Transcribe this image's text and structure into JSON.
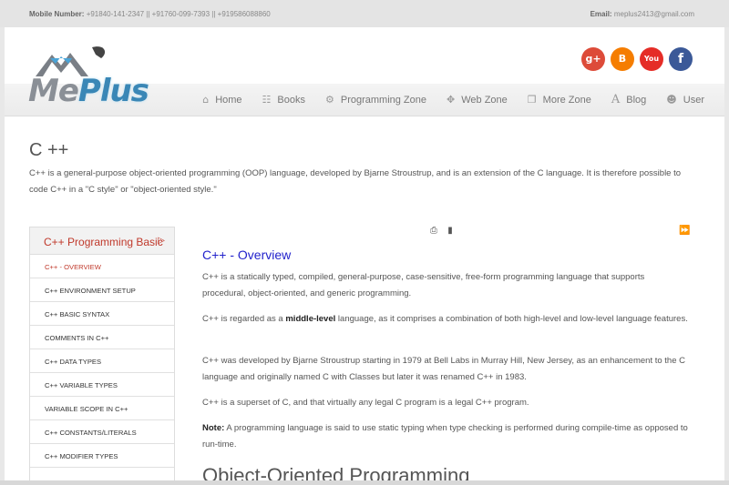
{
  "topbar": {
    "mobile_label": "Mobile Number:",
    "mobile_value": "+91840-141-2347 || +91760-099-7393 || +919586088860",
    "email_label": "Email:",
    "email_value": "meplus2413@gmail.com"
  },
  "logo": {
    "part1": "Me",
    "part2": "Plus"
  },
  "social": [
    {
      "label": "g+",
      "color": "#dd4b39"
    },
    {
      "label": "B",
      "color": "#f57d00"
    },
    {
      "label": "You",
      "color": "#e52d27"
    },
    {
      "label": "f",
      "color": "#3b5998"
    }
  ],
  "nav": [
    {
      "label": "Home",
      "icon": "home-icon"
    },
    {
      "label": "Books",
      "icon": "grid-icon"
    },
    {
      "label": "Programming Zone",
      "icon": "gears-icon"
    },
    {
      "label": "Web Zone",
      "icon": "move-icon"
    },
    {
      "label": "More Zone",
      "icon": "copy-icon"
    },
    {
      "label": "Blog",
      "icon": "font-icon"
    },
    {
      "label": "User",
      "icon": "user-icon"
    }
  ],
  "page": {
    "title": "C ++",
    "intro": "C++ is a general-purpose object-oriented programming (OOP) language, developed by Bjarne Stroustrup, and is an extension of the C language. It is therefore possible to code C++ in a \"C style\" or \"object-oriented style.\""
  },
  "sidebar": {
    "heading": "C++ Programming Basic",
    "items": [
      "C++ - OVERVIEW",
      "C++ ENVIRONMENT SETUP",
      "C++ BASIC SYNTAX",
      "COMMENTS IN C++",
      "C++ DATA TYPES",
      "C++ VARIABLE TYPES",
      "VARIABLE SCOPE IN C++",
      "C++ CONSTANTS/LITERALS",
      "C++ MODIFIER TYPES"
    ]
  },
  "content": {
    "heading": "C++ - Overview",
    "p1": "C++ is a statically typed, compiled, general-purpose, case-sensitive, free-form programming language that supports procedural, object-oriented, and generic programming.",
    "p2_before": "C++ is regarded as a ",
    "p2_bold": "middle-level",
    "p2_after": " language, as it comprises a combination of both high-level and low-level language features.",
    "p3": "C++ was developed by Bjarne Stroustrup starting in 1979 at Bell Labs in Murray Hill, New Jersey, as an enhancement to the C language and originally named C with Classes but later it was renamed C++ in 1983.",
    "p4": "C++ is a superset of C, and that virtually any legal C program is a legal C++ program.",
    "note_label": "Note:",
    "note_text": " A programming language is said to use static typing when type checking is performed during compile-time as opposed to run-time.",
    "heading2": "Object-Oriented Programming"
  }
}
